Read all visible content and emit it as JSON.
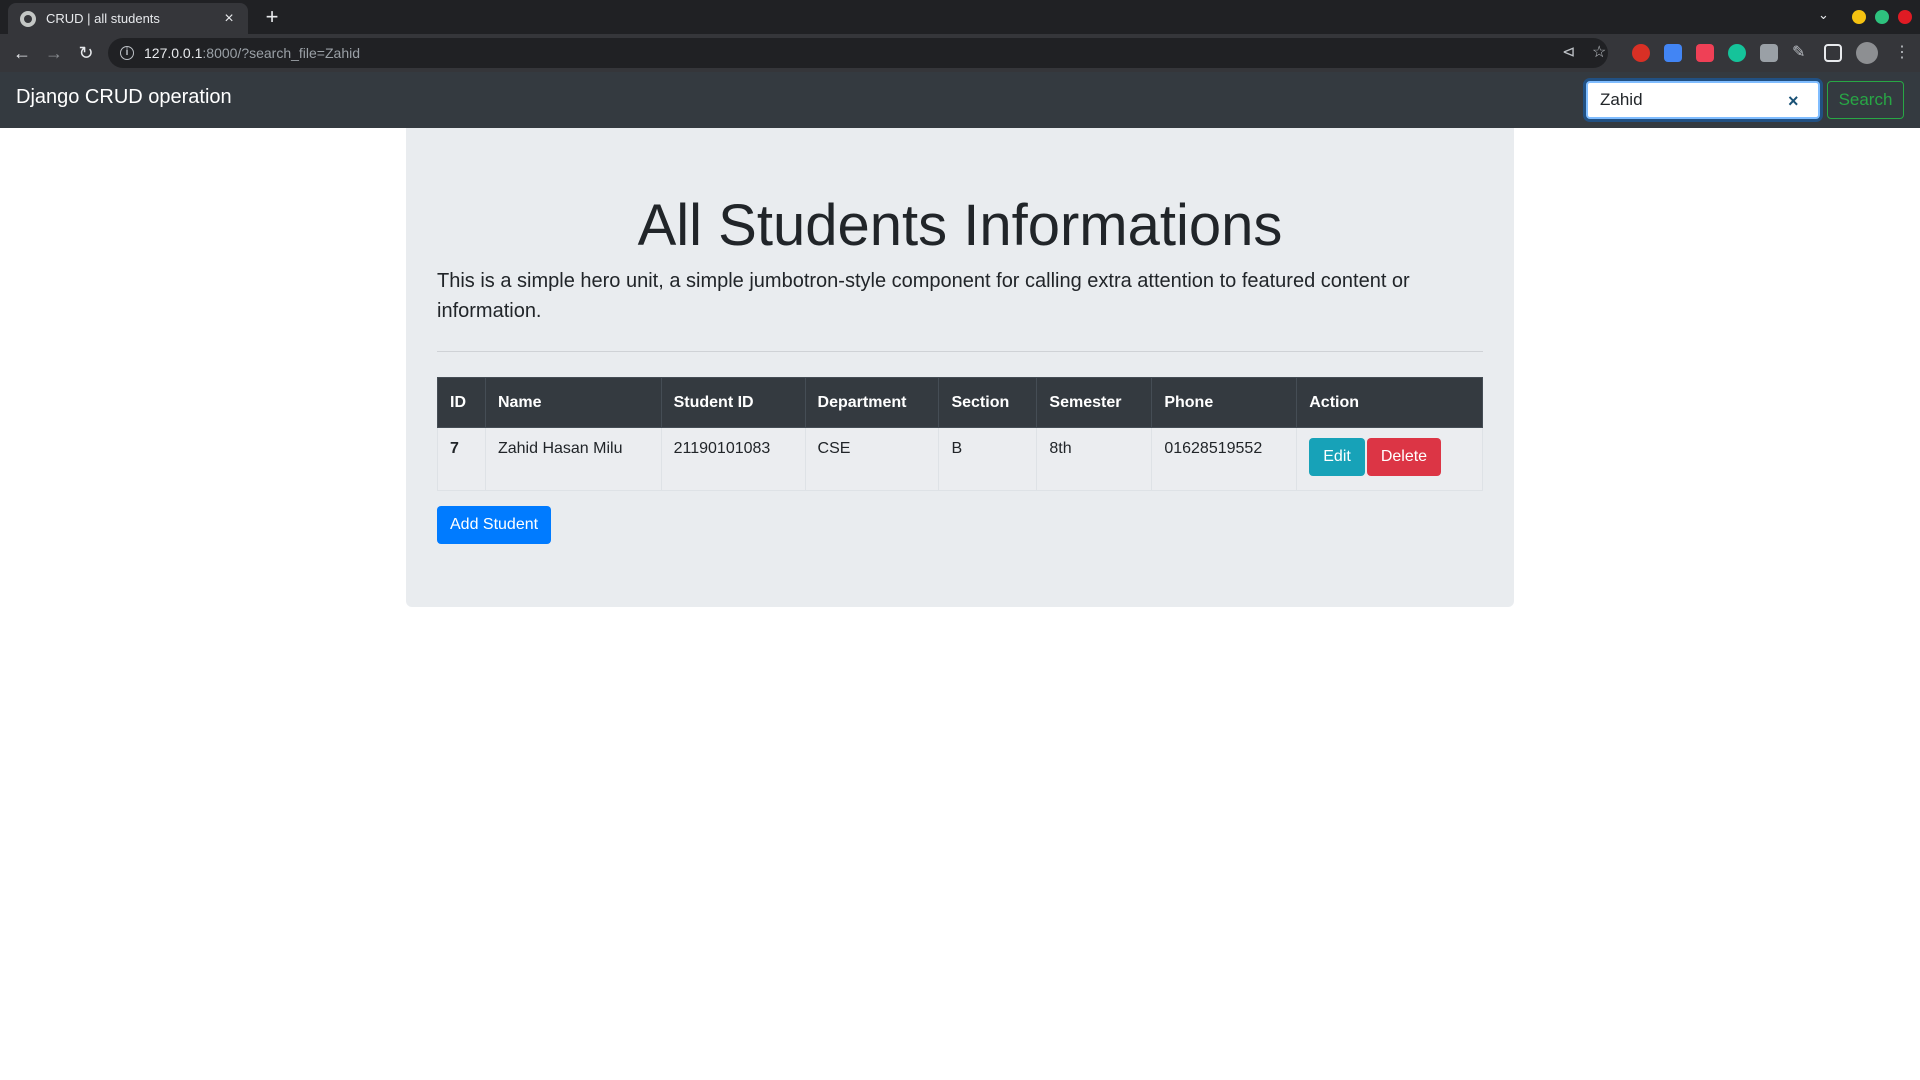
{
  "browser": {
    "tab_title": "CRUD | all students",
    "tab_close": "×",
    "new_tab": "+",
    "url_host": "127.0.0.1",
    "url_rest": ":8000/?search_file=Zahid"
  },
  "navbar": {
    "brand": "Django CRUD operation",
    "search_value": "Zahid",
    "search_clear": "×",
    "search_button": "Search"
  },
  "hero": {
    "title": "All Students Informations",
    "lead": "This is a simple hero unit, a simple jumbotron-style component for calling extra attention to featured content or information."
  },
  "table": {
    "headers": [
      "ID",
      "Name",
      "Student ID",
      "Department",
      "Section",
      "Semester",
      "Phone",
      "Action"
    ],
    "rows": [
      {
        "id": "7",
        "name": "Zahid Hasan Milu",
        "student_id": "21190101083",
        "department": "CSE",
        "section": "B",
        "semester": "8th",
        "phone": "01628519552",
        "edit_label": "Edit",
        "delete_label": "Delete"
      }
    ]
  },
  "actions": {
    "add_student": "Add Student"
  },
  "colors": {
    "navbar_bg": "#343a40",
    "jumbotron_bg": "#e9ecef",
    "primary": "#007bff",
    "info": "#17a2b8",
    "danger": "#dc3545",
    "success": "#28a745"
  }
}
